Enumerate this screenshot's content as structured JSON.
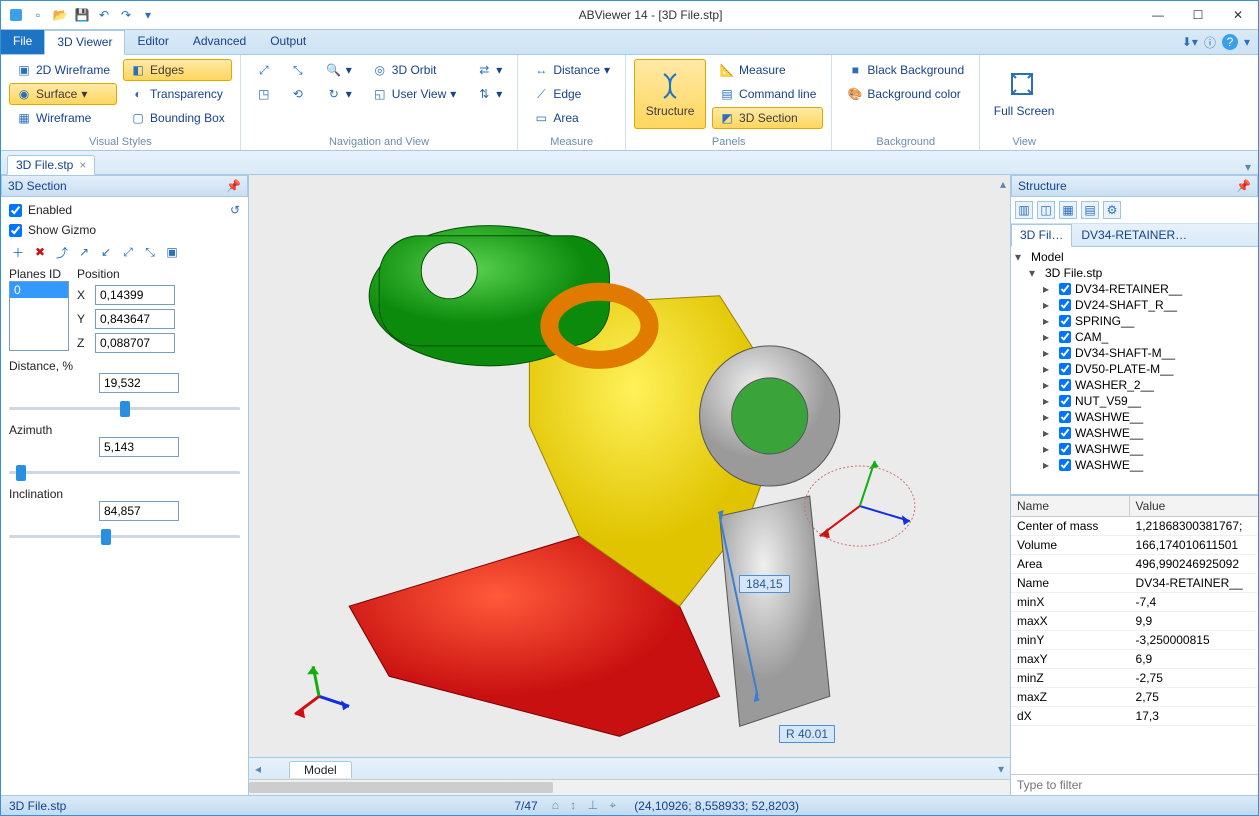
{
  "window": {
    "title": "ABViewer 14 - [3D File.stp]"
  },
  "tabs": {
    "file": "File",
    "viewer": "3D Viewer",
    "editor": "Editor",
    "advanced": "Advanced",
    "output": "Output"
  },
  "ribbon": {
    "visual_styles": {
      "label": "Visual Styles",
      "wireframe2d": "2D Wireframe",
      "edges": "Edges",
      "surface": "Surface",
      "transparency": "Transparency",
      "wireframe": "Wireframe",
      "bounding": "Bounding Box"
    },
    "nav": {
      "label": "Navigation and View",
      "orbit": "3D Orbit",
      "userview": "User View"
    },
    "measure": {
      "label": "Measure",
      "distance": "Distance",
      "edge": "Edge",
      "area": "Area"
    },
    "panels": {
      "label": "Panels",
      "structure": "Structure",
      "measure": "Measure",
      "cmd": "Command line",
      "section": "3D Section"
    },
    "background": {
      "label": "Background",
      "black": "Black Background",
      "color": "Background color"
    },
    "view": {
      "label": "View",
      "fullscreen": "Full Screen"
    }
  },
  "doc_tab": "3D File.stp",
  "left": {
    "title": "3D Section",
    "enabled": "Enabled",
    "gizmo": "Show Gizmo",
    "planes_id": "Planes ID",
    "planes_value": "0",
    "position": "Position",
    "x": "0,14399",
    "y": "0,843647",
    "z": "0,088707",
    "distance": "Distance, %",
    "distance_val": "19,532",
    "azimuth": "Azimuth",
    "azimuth_val": "5,143",
    "inclination": "Inclination",
    "inclination_val": "84,857"
  },
  "viewport": {
    "dim1": "184,15",
    "dim2": "R 40.01",
    "model_tab": "Model"
  },
  "right": {
    "title": "Structure",
    "tab1": "3D Fil…",
    "tab2": "DV34-RETAINER…",
    "tree": {
      "root": "Model",
      "file": "3D File.stp",
      "items": [
        "DV34-RETAINER__",
        "DV24-SHAFT_R__",
        "SPRING__",
        "CAM_",
        "DV34-SHAFT-M__",
        "DV50-PLATE-M__",
        "WASHER_2__",
        "NUT_V59__",
        "WASHWE__",
        "WASHWE__",
        "WASHWE__",
        "WASHWE__"
      ]
    },
    "props_hdr": {
      "name": "Name",
      "value": "Value"
    },
    "props": [
      {
        "n": "Center of mass",
        "v": "1,21868300381767;"
      },
      {
        "n": "Volume",
        "v": "166,174010611501"
      },
      {
        "n": "Area",
        "v": "496,990246925092"
      },
      {
        "n": "Name",
        "v": "DV34-RETAINER__"
      },
      {
        "n": "minX",
        "v": "-7,4"
      },
      {
        "n": "maxX",
        "v": "9,9"
      },
      {
        "n": "minY",
        "v": "-3,250000815"
      },
      {
        "n": "maxY",
        "v": "6,9"
      },
      {
        "n": "minZ",
        "v": "-2,75"
      },
      {
        "n": "maxZ",
        "v": "2,75"
      },
      {
        "n": "dX",
        "v": "17,3"
      }
    ],
    "filter_placeholder": "Type to filter"
  },
  "status": {
    "file": "3D File.stp",
    "page": "7/47",
    "coords": "(24,10926; 8,558933; 52,8203)"
  }
}
